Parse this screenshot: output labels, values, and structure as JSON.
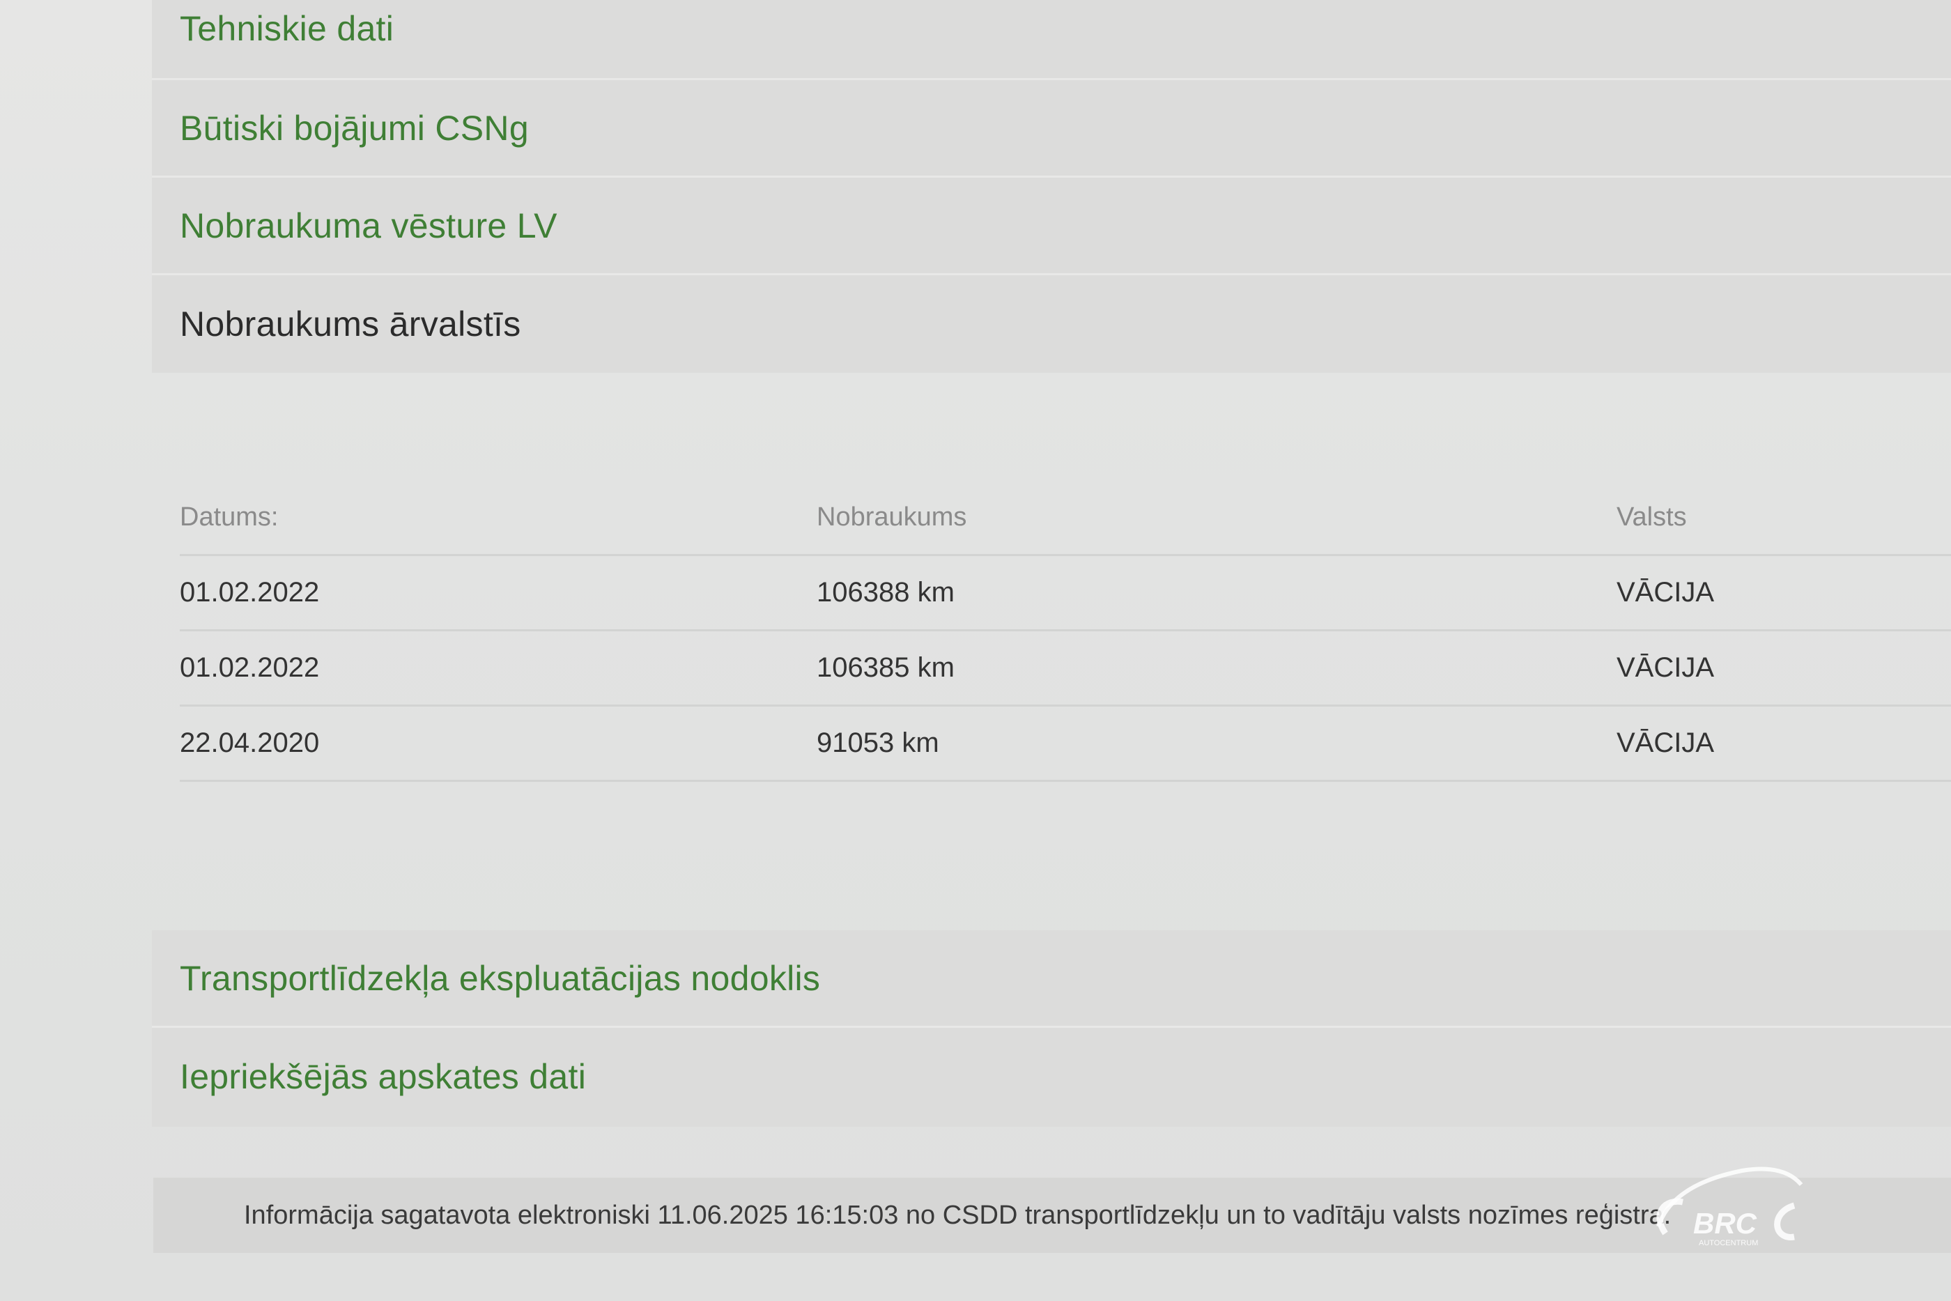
{
  "accordion_top": [
    {
      "label": "Tehniskie dati"
    },
    {
      "label": "Būtiski bojājumi CSNg"
    },
    {
      "label": "Nobraukuma vēsture LV"
    },
    {
      "label": "Nobraukums ārvalstīs"
    }
  ],
  "mileage_table": {
    "headers": {
      "date": "Datums:",
      "mileage": "Nobraukums",
      "country": "Valsts"
    },
    "rows": [
      {
        "date": "01.02.2022",
        "mileage": "106388 km",
        "country": "VĀCIJA"
      },
      {
        "date": "01.02.2022",
        "mileage": "106385 km",
        "country": "VĀCIJA"
      },
      {
        "date": "22.04.2020",
        "mileage": "91053 km",
        "country": "VĀCIJA"
      }
    ]
  },
  "accordion_bottom": [
    {
      "label": "Transportlīdzekļa ekspluatācijas nodoklis"
    },
    {
      "label": "Iepriekšējās apskates dati"
    }
  ],
  "footer": {
    "text": "Informācija sagatavota elektroniski 11.06.2025 16:15:03 no CSDD transportlīdzekļu un to vadītāju valsts nozīmes reģistra."
  },
  "watermark": {
    "brand": "BRC",
    "sub": "AUTOCENTRUM"
  },
  "colors": {
    "accent_green": "#3f7f35",
    "active_text": "#2b2b2b"
  }
}
